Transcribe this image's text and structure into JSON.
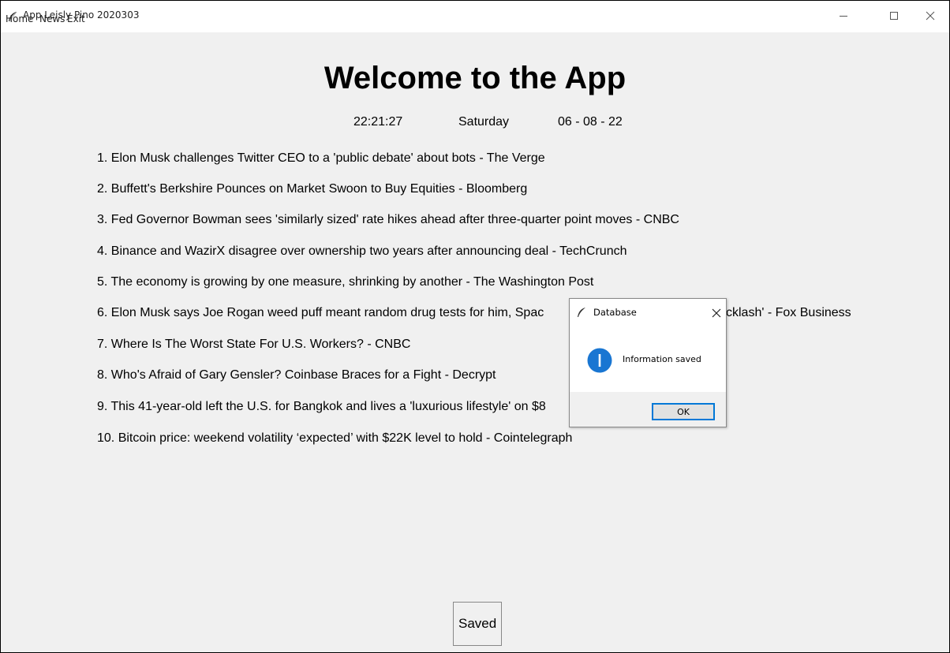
{
  "window": {
    "title": "App Leisly Pino 2020303",
    "menu": [
      "Home",
      "News",
      "Exit"
    ]
  },
  "main": {
    "heading": "Welcome to the App",
    "time": "22:21:27",
    "day": "Saturday",
    "date": "06 - 08 - 22",
    "news": [
      "1. Elon Musk challenges Twitter CEO to a 'public debate' about bots - The Verge",
      "2. Buffett's Berkshire Pounces on Market Swoon to Buy Equities - Bloomberg",
      "3. Fed Governor Bowman sees 'similarly sized' rate hikes ahead after three-quarter point moves - CNBC",
      "4. Binance and WazirX disagree over ownership two years after announcing deal - TechCrunch",
      "5. The economy is growing by one measure, shrinking by another - The Washington Post",
      "6. Elon Musk says Joe Rogan weed puff meant random drug tests for him, Spac",
      "7. Where Is The Worst State For U.S. Workers? - CNBC",
      "8. Who's Afraid of Gary Gensler? Coinbase Braces for a Fight - Decrypt",
      "9. This 41-year-old left the U.S. for Bangkok and lives a 'luxurious lifestyle' on $8",
      "10. Bitcoin price: weekend volatility ‘expected’ with $22K level to hold - Cointelegraph"
    ],
    "news6_tail": "cklash' - Fox Business",
    "saved_button": "Saved"
  },
  "dialog": {
    "title": "Database",
    "message": "Information saved",
    "ok_label": "OK"
  },
  "colors": {
    "accent": "#0078d7",
    "info_icon": "#1976d2",
    "background": "#f0f0f0"
  }
}
